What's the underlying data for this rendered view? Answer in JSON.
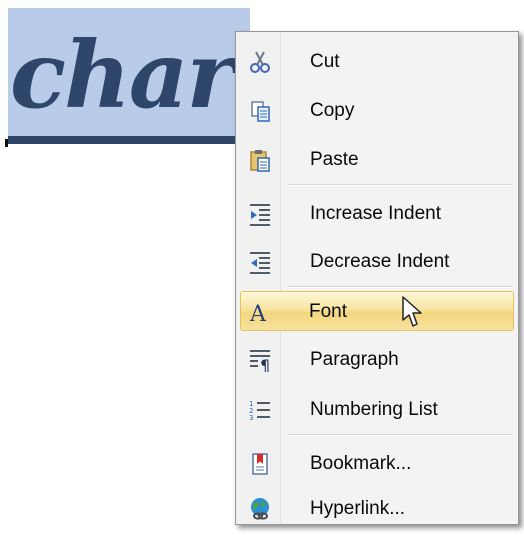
{
  "document": {
    "selected_text": "char"
  },
  "context_menu": {
    "items": [
      {
        "label": "Cut",
        "icon": "scissors-icon"
      },
      {
        "label": "Copy",
        "icon": "copy-icon"
      },
      {
        "label": "Paste",
        "icon": "clipboard-paste-icon"
      },
      {
        "label": "Increase Indent",
        "icon": "increase-indent-icon"
      },
      {
        "label": "Decrease Indent",
        "icon": "decrease-indent-icon"
      },
      {
        "label": "Font",
        "icon": "font-a-icon",
        "highlighted": true
      },
      {
        "label": "Paragraph",
        "icon": "paragraph-icon"
      },
      {
        "label": "Numbering List",
        "icon": "numbering-list-icon"
      },
      {
        "label": "Bookmark...",
        "icon": "bookmark-icon"
      },
      {
        "label": "Hyperlink...",
        "icon": "hyperlink-globe-icon"
      }
    ]
  },
  "colors": {
    "selection_background": "#b8cbe9",
    "document_text": "#2f466b",
    "hover_highlight": "#f4d67f",
    "menu_background": "#f3f3f3"
  }
}
